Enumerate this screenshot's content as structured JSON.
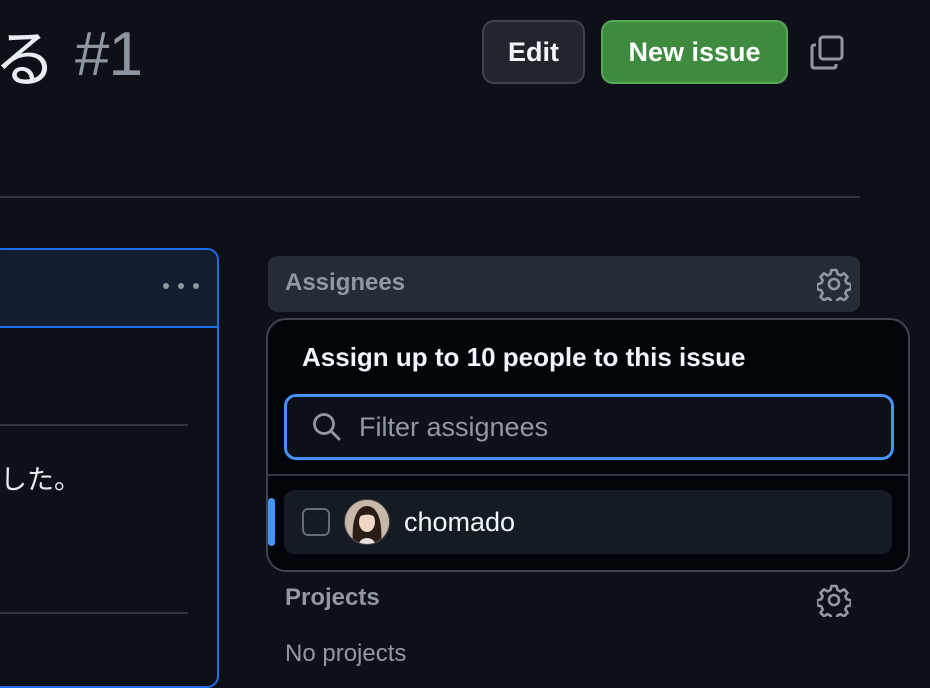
{
  "issue": {
    "title_fragment": "る",
    "number": "#1"
  },
  "header": {
    "edit_label": "Edit",
    "new_issue_label": "New issue"
  },
  "comment": {
    "text_fragment": "した。"
  },
  "sidebar": {
    "assignees_label": "Assignees",
    "projects_label": "Projects",
    "projects_empty": "No projects"
  },
  "assignee_dropdown": {
    "title": "Assign up to 10 people to this issue",
    "filter_placeholder": "Filter assignees",
    "filter_value": "",
    "users": [
      {
        "login": "chomado",
        "selected": false
      }
    ]
  },
  "colors": {
    "background": "#0d1117",
    "primary_button": "#3e8a3f",
    "focus_accent": "#4493f8"
  },
  "icons": [
    "copy-icon",
    "kebab-menu-icon",
    "gear-icon",
    "search-icon",
    "avatar-image"
  ]
}
